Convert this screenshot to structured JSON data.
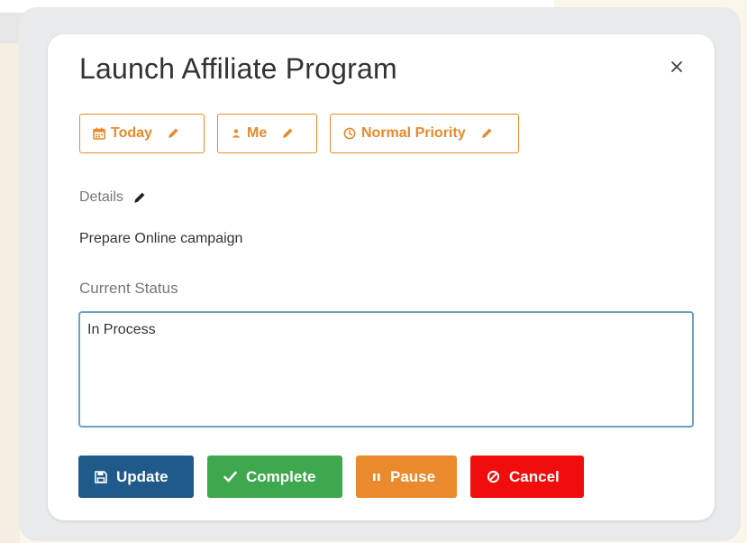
{
  "modal": {
    "title": "Launch Affiliate Program",
    "close_icon": "close-icon",
    "chips": [
      {
        "label": "Today",
        "icon": "calendar-icon"
      },
      {
        "label": "Me",
        "icon": "user-icon"
      },
      {
        "label": "Normal Priority",
        "icon": "clock-icon"
      }
    ],
    "details_label": "Details",
    "details_text": "Prepare Online campaign",
    "status_label": "Current Status",
    "status_value": "In Process",
    "buttons": {
      "update": "Update",
      "complete": "Complete",
      "pause": "Pause",
      "cancel": "Cancel"
    }
  },
  "colors": {
    "accent_orange": "#e8892b",
    "update_blue": "#1f5a8a",
    "complete_green": "#3ea84e",
    "pause_orange": "#ea8a2c",
    "cancel_red": "#f20d0d",
    "input_border": "#6e9fc9"
  }
}
